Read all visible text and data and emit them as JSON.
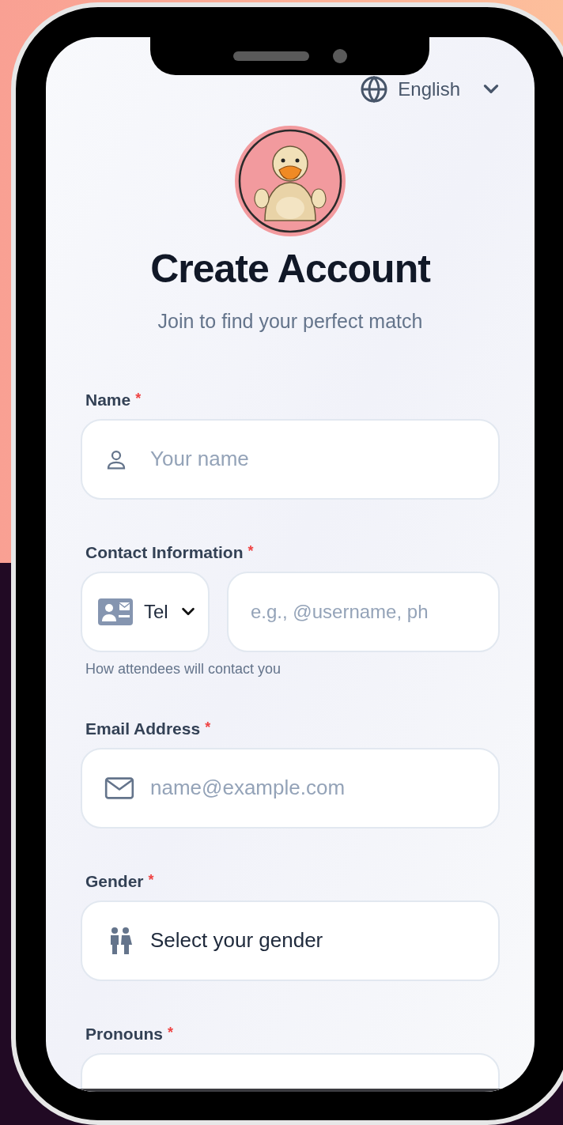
{
  "language": {
    "label": "English"
  },
  "header": {
    "title": "Create Account",
    "subtitle": "Join to find your perfect match"
  },
  "fields": [
    {
      "kind": "name",
      "label": "Name",
      "mark": "*",
      "placeholder": "Your name"
    },
    {
      "kind": "contact",
      "label": "Contact Information",
      "mark": "*",
      "method": "Tel",
      "placeholder": "e.g., @username, ph",
      "hint": "How attendees will contact you"
    },
    {
      "kind": "email",
      "label": "Email Address",
      "mark": "*",
      "placeholder": "name@example.com"
    },
    {
      "kind": "gender",
      "label": "Gender",
      "mark": "*",
      "value": "Select your gender"
    },
    {
      "kind": "pronouns",
      "label": "Pronouns",
      "mark": "*"
    }
  ]
}
